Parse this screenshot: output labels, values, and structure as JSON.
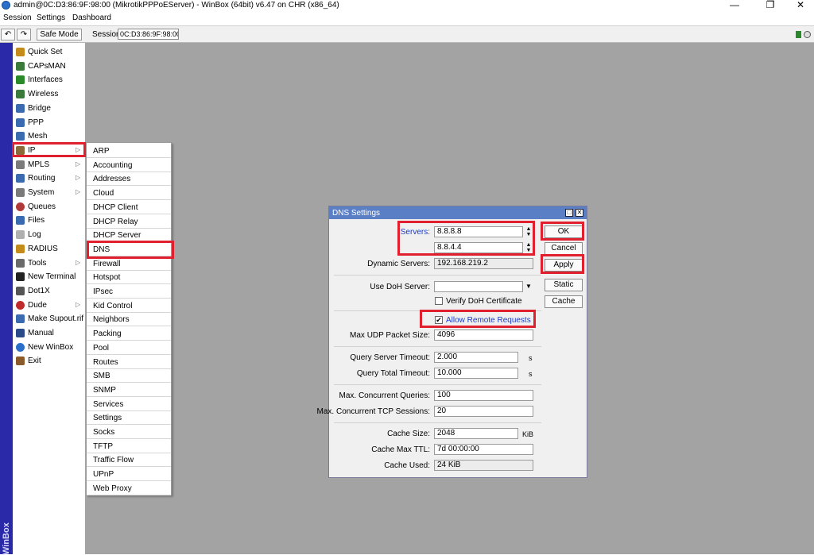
{
  "window": {
    "title": "admin@0C:D3:86:9F:98:00 (MikrotikPPPoEServer) - WinBox (64bit) v6.47 on CHR (x86_64)",
    "minimize_glyph": "—",
    "restore_glyph": "❐",
    "close_glyph": "✕"
  },
  "menubar": {
    "items": [
      "Session",
      "Settings",
      "Dashboard"
    ]
  },
  "toolbar": {
    "undo_glyph": "↶",
    "redo_glyph": "↷",
    "safe_mode_label": "Safe Mode",
    "session_label": "Session:",
    "session_value": "0C:D3:86:9F:98:00"
  },
  "brand": "WinBox",
  "sidebar": {
    "items": [
      {
        "label": "Quick Set",
        "icon": "wand-icon",
        "color": "#c58b1a",
        "arrow": false
      },
      {
        "label": "CAPsMAN",
        "icon": "antenna-icon",
        "color": "#3a7a3a",
        "arrow": false
      },
      {
        "label": "Interfaces",
        "icon": "interfaces-icon",
        "color": "#2a8a2a",
        "arrow": false
      },
      {
        "label": "Wireless",
        "icon": "wireless-icon",
        "color": "#3a7a3a",
        "arrow": false
      },
      {
        "label": "Bridge",
        "icon": "bridge-icon",
        "color": "#3a6ab0",
        "arrow": false
      },
      {
        "label": "PPP",
        "icon": "ppp-icon",
        "color": "#3a6ab0",
        "arrow": false
      },
      {
        "label": "Mesh",
        "icon": "mesh-icon",
        "color": "#3a6ab0",
        "arrow": false
      },
      {
        "label": "IP",
        "icon": "ip-icon",
        "color": "#8a6a3a",
        "arrow": true
      },
      {
        "label": "MPLS",
        "icon": "mpls-icon",
        "color": "#7a7a7a",
        "arrow": true
      },
      {
        "label": "Routing",
        "icon": "routing-icon",
        "color": "#3a6ab0",
        "arrow": true
      },
      {
        "label": "System",
        "icon": "gear-icon",
        "color": "#7a7a7a",
        "arrow": true
      },
      {
        "label": "Queues",
        "icon": "queues-icon",
        "color": "#b03a3a",
        "arrow": false
      },
      {
        "label": "Files",
        "icon": "folder-icon",
        "color": "#3a6ab0",
        "arrow": false
      },
      {
        "label": "Log",
        "icon": "log-icon",
        "color": "#b0b0b0",
        "arrow": false
      },
      {
        "label": "RADIUS",
        "icon": "radius-icon",
        "color": "#c58b1a",
        "arrow": false
      },
      {
        "label": "Tools",
        "icon": "tools-icon",
        "color": "#6a6a6a",
        "arrow": true
      },
      {
        "label": "New Terminal",
        "icon": "terminal-icon",
        "color": "#222222",
        "arrow": false
      },
      {
        "label": "Dot1X",
        "icon": "dot1x-icon",
        "color": "#555555",
        "arrow": false
      },
      {
        "label": "Dude",
        "icon": "dude-icon",
        "color": "#c02a2a",
        "arrow": true
      },
      {
        "label": "Make Supout.rif",
        "icon": "supout-icon",
        "color": "#3a6ab0",
        "arrow": false
      },
      {
        "label": "Manual",
        "icon": "manual-icon",
        "color": "#2a4a8a",
        "arrow": false
      },
      {
        "label": "New WinBox",
        "icon": "winbox-icon",
        "color": "#2a6fc9",
        "arrow": false
      },
      {
        "label": "Exit",
        "icon": "exit-icon",
        "color": "#8a5a2a",
        "arrow": false
      }
    ],
    "arrow_glyph": "▷"
  },
  "ip_submenu": {
    "items": [
      "ARP",
      "Accounting",
      "Addresses",
      "Cloud",
      "DHCP Client",
      "DHCP Relay",
      "DHCP Server",
      "DNS",
      "Firewall",
      "Hotspot",
      "IPsec",
      "Kid Control",
      "Neighbors",
      "Packing",
      "Pool",
      "Routes",
      "SMB",
      "SNMP",
      "Services",
      "Settings",
      "Socks",
      "TFTP",
      "Traffic Flow",
      "UPnP",
      "Web Proxy"
    ]
  },
  "dns_dialog": {
    "title": "DNS Settings",
    "servers_label": "Servers:",
    "server1": "8.8.8.8",
    "server2": "8.8.4.4",
    "dynamic_servers_label": "Dynamic Servers:",
    "dynamic_servers": "192.168.219.2",
    "use_doh_label": "Use DoH Server:",
    "use_doh_value": "",
    "verify_doh_label": "Verify DoH Certificate",
    "verify_doh_checked": false,
    "allow_remote_label": "Allow Remote Requests",
    "allow_remote_checked": true,
    "max_udp_label": "Max UDP Packet Size:",
    "max_udp": "4096",
    "query_server_timeout_label": "Query Server Timeout:",
    "query_server_timeout": "2.000",
    "query_total_timeout_label": "Query Total Timeout:",
    "query_total_timeout": "10.000",
    "seconds_unit": "s",
    "max_concurrent_label": "Max. Concurrent Queries:",
    "max_concurrent": "100",
    "max_tcp_label": "Max. Concurrent TCP Sessions:",
    "max_tcp": "20",
    "cache_size_label": "Cache Size:",
    "cache_size": "2048",
    "cache_size_unit": "KiB",
    "cache_ttl_label": "Cache Max TTL:",
    "cache_ttl": "7d 00:00:00",
    "cache_used_label": "Cache Used:",
    "cache_used": "24 KiB",
    "buttons": {
      "ok": "OK",
      "cancel": "Cancel",
      "apply": "Apply",
      "static": "Static",
      "cache": "Cache"
    }
  },
  "colors": {
    "highlight": "#e01f2f",
    "dialog_title": "#5b7fc4",
    "brand_strip": "#2a2aa8",
    "link_text": "#1a3ac8"
  }
}
